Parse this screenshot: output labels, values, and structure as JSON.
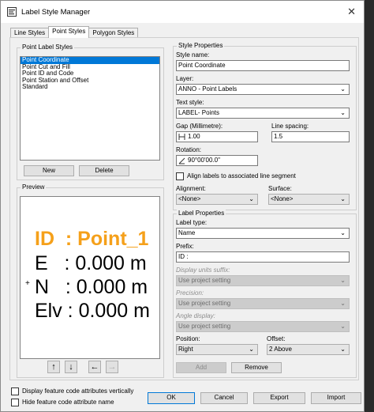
{
  "window": {
    "title": "Label Style Manager",
    "close": "✕"
  },
  "tabs": [
    "Line Styles",
    "Point Styles",
    "Polygon Styles"
  ],
  "point_label_styles": {
    "heading": "Point Label Styles",
    "items": [
      "Point Coordinate",
      "Point Cut and Fill",
      "Point ID and Code",
      "Point Station and Offset",
      "Standard"
    ],
    "new_label": "New",
    "delete_label": "Delete"
  },
  "preview": {
    "heading": "Preview",
    "lines": [
      "ID  : Point_1",
      "E   : 0.000 m",
      "N   : 0.000 m",
      "Elv : 0.000 m"
    ],
    "highlight_color": "#f5a01a",
    "marker": "+",
    "buttons": [
      "↑",
      "↓",
      "←",
      "→"
    ]
  },
  "style_properties": {
    "heading": "Style Properties",
    "style_name_label": "Style name:",
    "style_name_value": "Point Coordinate",
    "layer_label": "Layer:",
    "layer_value": "ANNO - Point Labels",
    "text_style_label": "Text style:",
    "text_style_value": "LABEL- Points",
    "gap_label": "Gap (Millimetre):",
    "gap_value": "1.00",
    "line_spacing_label": "Line spacing:",
    "line_spacing_value": "1.5",
    "rotation_label": "Rotation:",
    "rotation_value": "90°00'00.0\"",
    "align_label": "Align labels to associated line segment",
    "alignment_label": "Alignment:",
    "alignment_value": "<None>",
    "surface_label": "Surface:",
    "surface_value": "<None>"
  },
  "label_properties": {
    "heading": "Label Properties",
    "label_type_label": "Label type:",
    "label_type_value": "Name",
    "prefix_label": "Prefix:",
    "prefix_value": "ID  :",
    "units_suffix_label": "Display units suffix:",
    "units_suffix_value": "Use project setting",
    "precision_label": "Precision:",
    "precision_value": "Use project setting",
    "angle_label": "Angle display:",
    "angle_value": "Use project setting",
    "position_label": "Position:",
    "position_value": "Right",
    "offset_label": "Offset:",
    "offset_value": "2 Above",
    "add_label": "Add",
    "remove_label": "Remove"
  },
  "footer": {
    "display_attrs_label": "Display feature code attributes vertically",
    "hide_name_label": "Hide feature code attribute name",
    "ok": "OK",
    "cancel": "Cancel",
    "export": "Export",
    "import": "Import"
  },
  "icons": {
    "app": "label-manager-icon",
    "chevron": "⌵"
  }
}
